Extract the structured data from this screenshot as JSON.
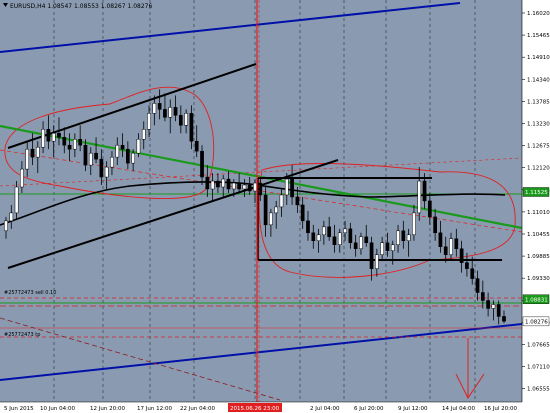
{
  "chart": {
    "title": "EURUSD,H4  1.08547 1.08553 1.08267 1.08276",
    "background": "#8a9bb1",
    "price_levels": [
      "1.16020",
      "1.15465",
      "1.14910",
      "1.14340",
      "1.13785",
      "1.13230",
      "1.12675",
      "1.12120",
      "1.11565",
      "1.11010",
      "1.10455",
      "1.09885",
      "1.09330",
      "1.08775",
      "1.08220",
      "1.07665",
      "1.07110",
      "1.06555"
    ],
    "price_tags": {
      "green": "1.11525",
      "green2": "1.08831",
      "current": "1.08276"
    },
    "time_labels": [
      "5 Jun 2015",
      "10 Jun 04:00",
      "12 Jun 20:00",
      "17 Jun 12:00",
      "22 Jun 04:00",
      "2015.06.26 23:00",
      "2 Jul 04:00",
      "6 Jul 20:00",
      "9 Jul 12:00",
      "14 Jul 04:00",
      "16 Jul 20:00"
    ],
    "vline_label": "2015.06.26 23:00",
    "objects": {
      "fibo_label": "#25772473 sell 0.10",
      "tp_label": "#25772473 tp"
    },
    "colors": {
      "bullish": "#ffffff",
      "bearish": "#000000",
      "wick": "#000000",
      "blue_channel": "#0010a8",
      "green_line": "#1a9a1a",
      "red": "#e02020",
      "ma": "#000000"
    }
  }
}
